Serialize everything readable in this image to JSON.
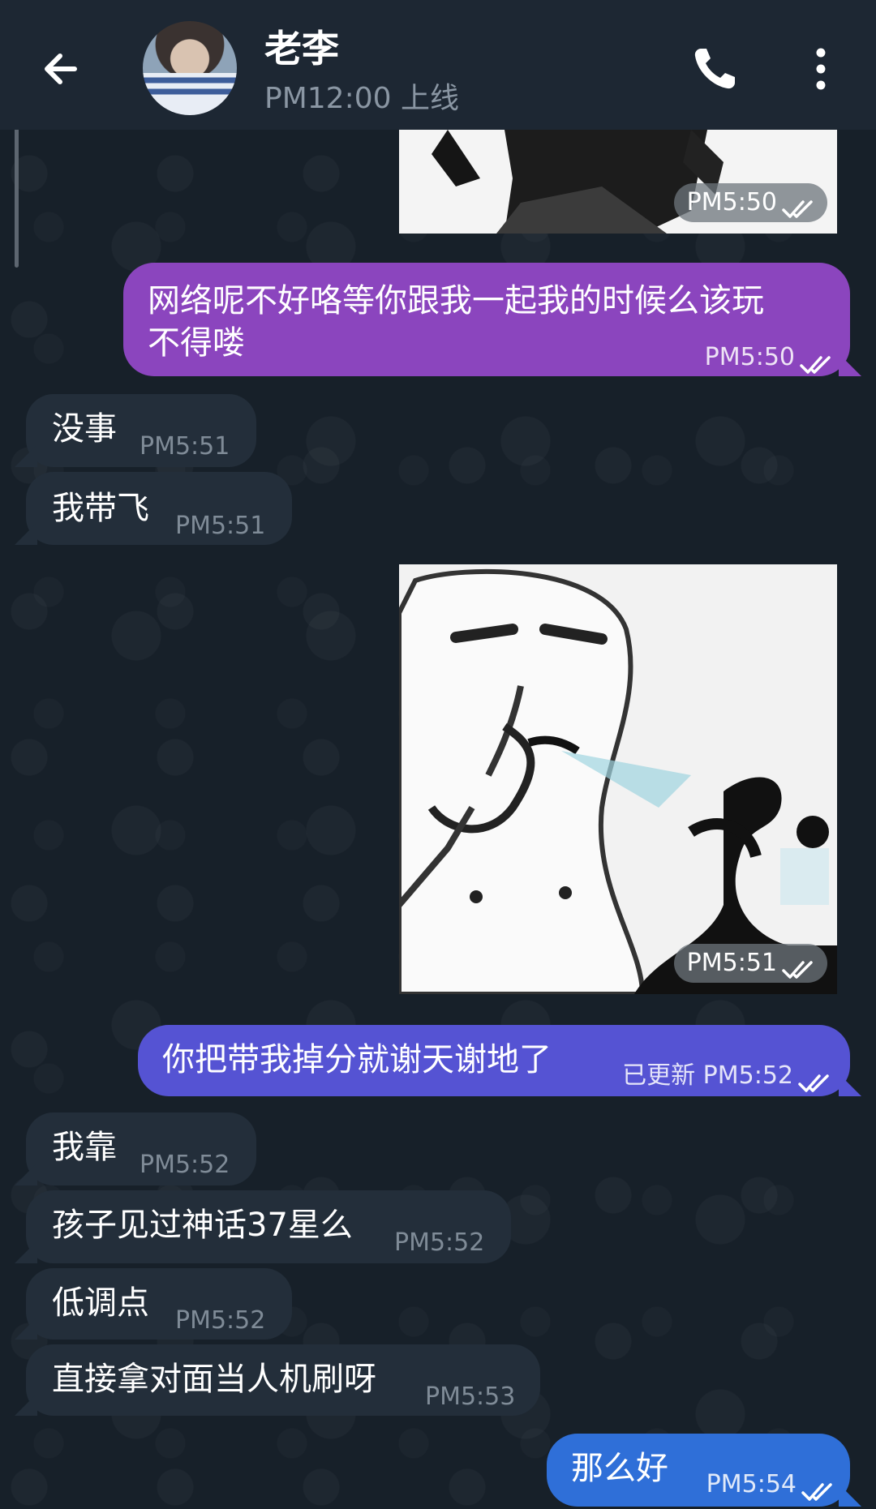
{
  "header": {
    "contact_name": "老李",
    "status": "PM12:00 上线"
  },
  "colors": {
    "header_bg": "#1d2733",
    "chat_bg": "#172029",
    "incoming_bubble": "#232e3a",
    "outgoing_purple": "#8b45be",
    "outgoing_indigo": "#5553d3",
    "outgoing_blue": "#2f6fd8"
  },
  "messages": [
    {
      "id": "img1",
      "type": "image",
      "direction": "out",
      "time": "PM5:50",
      "status_icon": "double-check-icon"
    },
    {
      "id": "m1",
      "direction": "out",
      "line1": "网络呢不好咯等你跟我一起我的时候么该玩",
      "line2": "不得喽",
      "time": "PM5:50",
      "status_icon": "double-check-icon"
    },
    {
      "id": "m2",
      "direction": "in",
      "text": "没事",
      "time": "PM5:51"
    },
    {
      "id": "m3",
      "direction": "in",
      "text": "我带飞",
      "time": "PM5:51"
    },
    {
      "id": "img2",
      "type": "image",
      "direction": "out",
      "time": "PM5:51",
      "status_icon": "double-check-icon"
    },
    {
      "id": "m4",
      "direction": "out",
      "text": "你把带我掉分就谢天谢地了",
      "edited": "已更新",
      "time": "PM5:52",
      "status_icon": "double-check-icon"
    },
    {
      "id": "m5",
      "direction": "in",
      "text": "我靠",
      "time": "PM5:52"
    },
    {
      "id": "m6",
      "direction": "in",
      "text": "孩子见过神话37星么",
      "time": "PM5:52"
    },
    {
      "id": "m7",
      "direction": "in",
      "text": "低调点",
      "time": "PM5:52"
    },
    {
      "id": "m8",
      "direction": "in",
      "text": "直接拿对面当人机刷呀",
      "time": "PM5:53"
    },
    {
      "id": "m9",
      "direction": "out",
      "text": "那么好",
      "time": "PM5:54",
      "status_icon": "double-check-icon"
    }
  ]
}
